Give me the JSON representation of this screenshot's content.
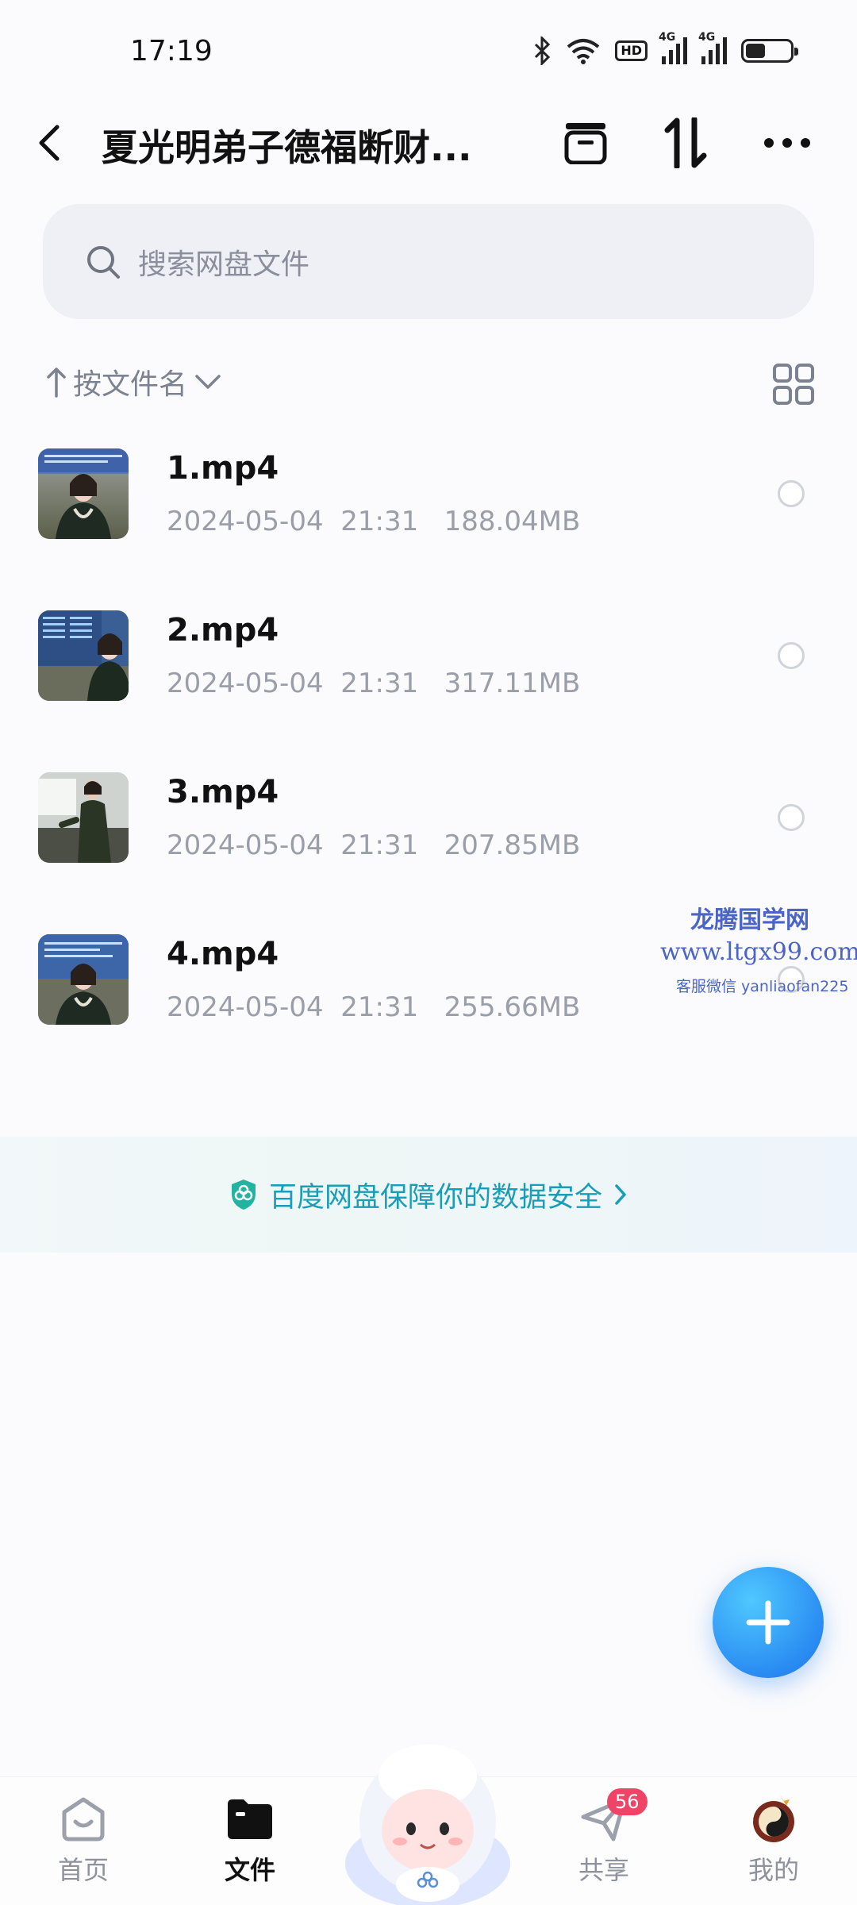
{
  "status_bar": {
    "time": "17:19",
    "icons": [
      "bluetooth-icon",
      "wifi-icon",
      "hd-icon",
      "signal-4g-icon",
      "signal-4g-icon",
      "battery-icon"
    ],
    "hd_label": "HD",
    "network_label": "4G",
    "battery_level": 0.45
  },
  "header": {
    "title": "夏光明弟子德福断财...",
    "back_icon": "back-arrow-icon",
    "actions": [
      "archive-icon",
      "sort-transfer-icon",
      "more-icon"
    ]
  },
  "search": {
    "placeholder": "搜索网盘文件"
  },
  "sort": {
    "label": "按文件名"
  },
  "files": [
    {
      "name": "1.mp4",
      "date": "2024-05-04",
      "time": "21:31",
      "size": "188.04MB"
    },
    {
      "name": "2.mp4",
      "date": "2024-05-04",
      "time": "21:31",
      "size": "317.11MB"
    },
    {
      "name": "3.mp4",
      "date": "2024-05-04",
      "time": "21:31",
      "size": "207.85MB"
    },
    {
      "name": "4.mp4",
      "date": "2024-05-04",
      "time": "21:31",
      "size": "255.66MB"
    }
  ],
  "watermark": {
    "line1": "龙腾国学网",
    "line2": "www.ltgx99.com",
    "line3": "客服微信 yanliaofan225"
  },
  "security_banner": {
    "text": "百度网盘保障你的数据安全"
  },
  "bottom_nav": {
    "home": "首页",
    "files": "文件",
    "share": "共享",
    "share_badge": "56",
    "me": "我的"
  },
  "colors": {
    "accent": "#2a8cf2",
    "security_text": "#1a9db6",
    "badge": "#f04466",
    "watermark": "#4a64c8"
  }
}
